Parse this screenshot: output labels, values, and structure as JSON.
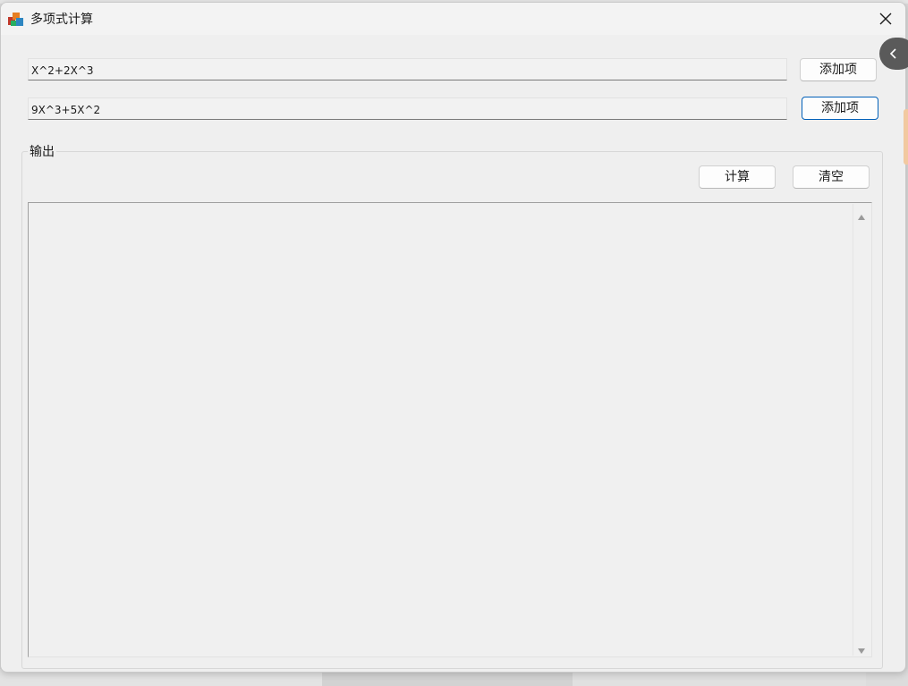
{
  "window": {
    "title": "多项式计算"
  },
  "inputs": {
    "poly1": {
      "value": "X^2+2X^3"
    },
    "poly2": {
      "value": "9X^3+5X^2"
    }
  },
  "buttons": {
    "add1_label": "添加项",
    "add2_label": "添加项",
    "compute_label": "计算",
    "clear_label": "清空"
  },
  "output": {
    "group_label": "输出",
    "text": ""
  },
  "icons": {
    "app": "app-icon",
    "close": "close-icon",
    "collapse": "chevron-left-icon",
    "scroll_up": "scroll-up-arrow-icon",
    "scroll_down": "scroll-down-arrow-icon"
  },
  "colors": {
    "window_bg": "#efefef",
    "focus_border": "#005fb8",
    "side_pull": "#5a5a5a"
  }
}
